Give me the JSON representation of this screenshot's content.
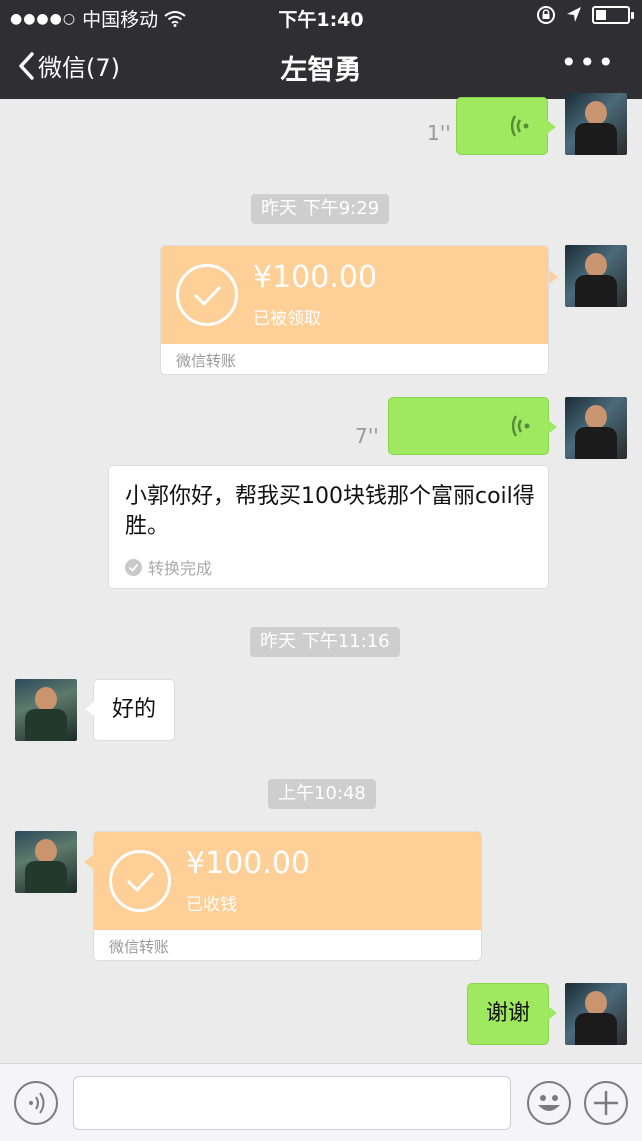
{
  "status_bar": {
    "signal": "●●●●○",
    "carrier": "中国移动",
    "time": "下午1:40"
  },
  "nav": {
    "back_label": "微信(7)",
    "title": "左智勇",
    "more": "•••"
  },
  "messages": {
    "voice1_duration": "1''",
    "time1": "昨天 下午9:29",
    "transfer1": {
      "amount": "¥100.00",
      "status": "已被领取",
      "label": "微信转账"
    },
    "voice2_duration": "7''",
    "transcript": {
      "text": "小郭你好，帮我买100块钱那个富丽coil得胜。",
      "status": "转换完成"
    },
    "time2": "昨天 下午11:16",
    "reply_text": "好的",
    "time3": "上午10:48",
    "transfer2": {
      "amount": "¥100.00",
      "status": "已收钱",
      "label": "微信转账"
    },
    "thanks_text": "谢谢"
  },
  "colors": {
    "nav_bg": "#2e2e33",
    "chat_bg": "#ebebeb",
    "green_bubble": "#9ee95f",
    "transfer_orange": "#fecf96"
  },
  "icons": [
    "back-chevron-icon",
    "more-icon",
    "voice-wave-icon",
    "check-circle-icon",
    "voice-mode-icon",
    "emoji-icon",
    "plus-icon",
    "wifi-icon",
    "lock-rotation-icon",
    "location-icon",
    "battery-icon"
  ]
}
